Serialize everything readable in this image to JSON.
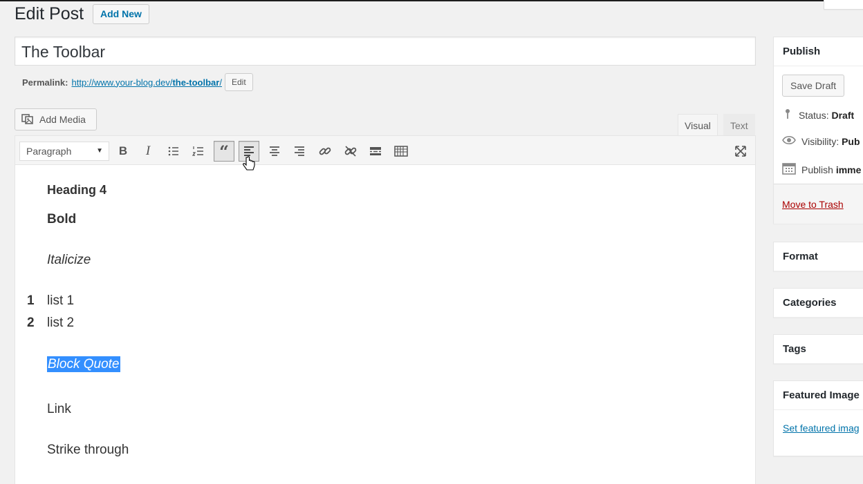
{
  "page": {
    "title": "Edit Post",
    "add_new": "Add New"
  },
  "post": {
    "title": "The Toolbar",
    "permalink_label": "Permalink:",
    "permalink_base": "http://www.your-blog.dev/",
    "permalink_slug": "the-toolbar",
    "permalink_trail": "/",
    "edit_label": "Edit"
  },
  "editor": {
    "add_media": "Add Media",
    "tab_visual": "Visual",
    "tab_text": "Text",
    "format_value": "Paragraph",
    "toolbar_icons": [
      "bold-icon",
      "italic-icon",
      "bullet-list-icon",
      "numbered-list-icon",
      "blockquote-icon",
      "align-left-icon",
      "align-center-icon",
      "align-right-icon",
      "link-icon",
      "unlink-icon",
      "read-more-icon",
      "toolbar-toggle-icon",
      "fullscreen-icon"
    ],
    "active_icons": [
      "blockquote-icon",
      "align-left-icon"
    ],
    "content": {
      "heading4": "Heading 4",
      "bold": "Bold",
      "italic": "Italicize",
      "list": [
        {
          "num": "1",
          "text": "list 1"
        },
        {
          "num": "2",
          "text": "list 2"
        }
      ],
      "blockquote": "Block Quote",
      "link": "Link",
      "strike": "Strike through"
    }
  },
  "sidebar": {
    "publish": {
      "title": "Publish",
      "save_draft": "Save Draft",
      "status_label": "Status:",
      "status_value": "Draft",
      "visibility_label": "Visibility:",
      "visibility_value": "Pub",
      "publish_label": "Publish",
      "publish_value": "imme",
      "trash": "Move to Trash"
    },
    "format": {
      "title": "Format"
    },
    "categories": {
      "title": "Categories"
    },
    "tags": {
      "title": "Tags"
    },
    "featured": {
      "title": "Featured Image",
      "link": "Set featured imag"
    }
  },
  "colors": {
    "link": "#0073aa",
    "selection": "#338fff",
    "trash": "#a00000"
  }
}
